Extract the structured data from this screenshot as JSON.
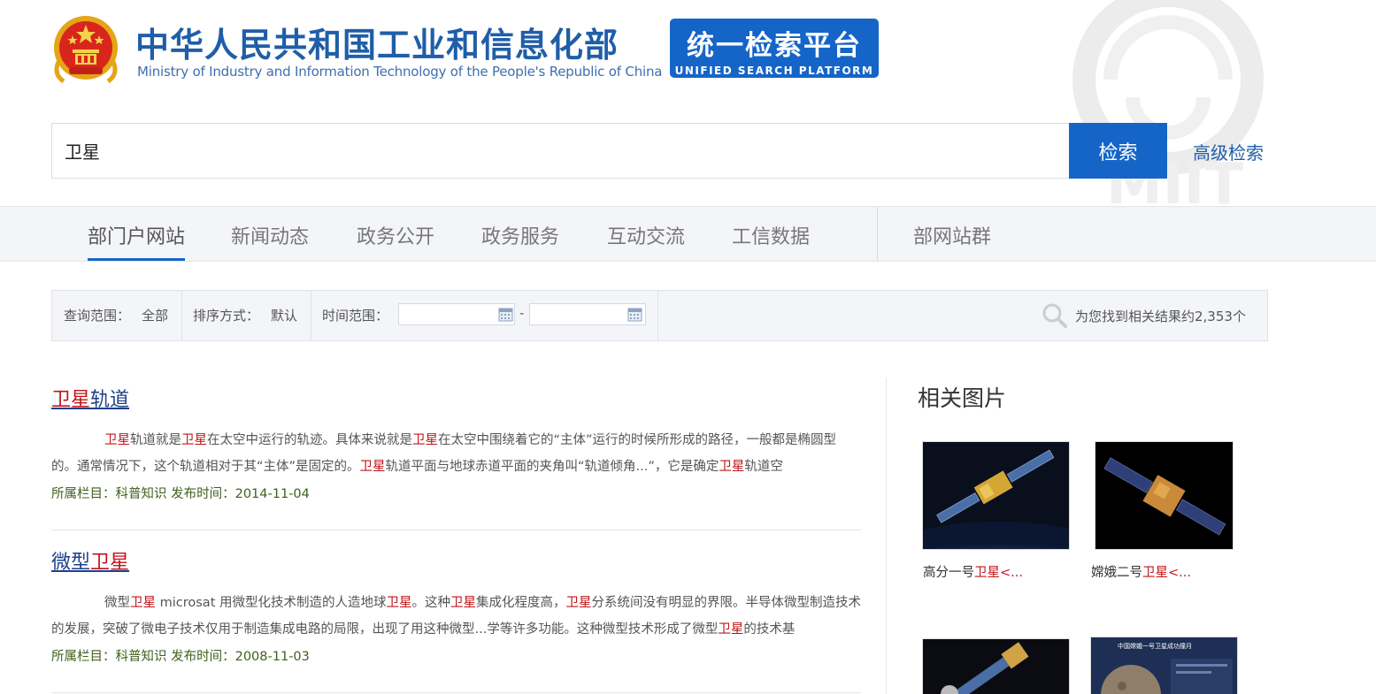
{
  "header": {
    "title_cn": "中华人民共和国工业和信息化部",
    "title_en": "Ministry of Industry and Information Technology of the People's Republic of China",
    "platform_cn": "统一检索平台",
    "platform_en": "UNIFIED SEARCH PLATFORM",
    "watermark_text": "MIIT"
  },
  "search": {
    "query": "卫星",
    "button_label": "检索",
    "advanced_label": "高级检索"
  },
  "nav": {
    "tabs": [
      {
        "label": "部门户网站",
        "active": true
      },
      {
        "label": "新闻动态",
        "active": false
      },
      {
        "label": "政务公开",
        "active": false
      },
      {
        "label": "政务服务",
        "active": false
      },
      {
        "label": "互动交流",
        "active": false
      },
      {
        "label": "工信数据",
        "active": false
      }
    ],
    "extra_tab": "部网站群"
  },
  "filters": {
    "scope_label": "查询范围：",
    "scope_value": "全部",
    "sort_label": "排序方式：",
    "sort_value": "默认",
    "time_label": "时间范围：",
    "date_from": "",
    "date_to": "",
    "date_separator": "-",
    "results_summary": "为您找到相关结果约2,353个"
  },
  "results": [
    {
      "title_hl": "卫星",
      "title_rest": "轨道",
      "snippet": [
        {
          "t": "卫星",
          "h": true
        },
        {
          "t": "轨道就是",
          "h": false
        },
        {
          "t": "卫星",
          "h": true
        },
        {
          "t": "在太空中运行的轨迹。具体来说就是",
          "h": false
        },
        {
          "t": "卫星",
          "h": true
        },
        {
          "t": "在太空中围绕着它的“主体”运行的时候所形成的路径，一般都是椭圆型的。通常情况下，这个轨道相对于其“主体”是固定的。",
          "h": false
        },
        {
          "t": "卫星",
          "h": true
        },
        {
          "t": "轨道平面与地球赤道平面的夹角叫“轨道倾角...”，它是确定",
          "h": false
        },
        {
          "t": "卫星",
          "h": true
        },
        {
          "t": "轨道空",
          "h": false
        }
      ],
      "meta": "所属栏目：科普知识 发布时间：2014-11-04"
    },
    {
      "title_pre": "微型",
      "title_hl": "卫星",
      "snippet": [
        {
          "t": "微型",
          "h": false
        },
        {
          "t": "卫星",
          "h": true
        },
        {
          "t": " microsat 用微型化技术制造的人造地球",
          "h": false
        },
        {
          "t": "卫星",
          "h": true
        },
        {
          "t": "。这种",
          "h": false
        },
        {
          "t": "卫星",
          "h": true
        },
        {
          "t": "集成化程度高，",
          "h": false
        },
        {
          "t": "卫星",
          "h": true
        },
        {
          "t": "分系统间没有明显的界限。半导体微型制造技术的发展，突破了微电子技术仅用于制造集成电路的局限，出现了用这种微型...学等许多功能。这种微型技术形成了微型",
          "h": false
        },
        {
          "t": "卫星",
          "h": true
        },
        {
          "t": "的技术基",
          "h": false
        }
      ],
      "meta": "所属栏目：科普知识 发布时间：2008-11-03"
    }
  ],
  "related": {
    "heading": "相关图片",
    "items": [
      {
        "pre": "高分一号",
        "hl": "卫星",
        "post": "<..."
      },
      {
        "pre": "嫦娥二号",
        "hl": "卫星",
        "post": "<..."
      }
    ],
    "thumb4_text": "中国嫦娥一号卫星成功撞月"
  },
  "colors": {
    "brand_blue": "#1565c8",
    "highlight_red": "#c0141a",
    "meta_green": "#3f5f1c",
    "title_navy": "#1f3f88"
  }
}
